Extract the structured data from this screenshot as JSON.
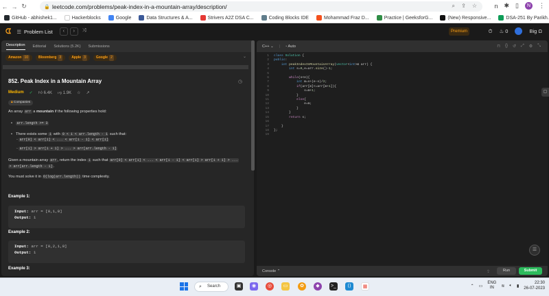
{
  "browser": {
    "url": "leetcode.com/problems/peak-index-in-a-mountain-array/description/",
    "profile_initial": "N",
    "bookmarks": [
      {
        "label": "GitHub - abhishek1...",
        "color": "#24292e"
      },
      {
        "label": "Hackerblocks",
        "color": "#ffffff"
      },
      {
        "label": "Google",
        "color": "#4285f4"
      },
      {
        "label": "Data Structures & A...",
        "color": "#3b5998"
      },
      {
        "label": "Strivers A2Z DSA C...",
        "color": "#e53935"
      },
      {
        "label": "Coding Blocks IDE",
        "color": "#607d8b"
      },
      {
        "label": "Mohammad Fraz D...",
        "color": "#f4511e"
      },
      {
        "label": "Practice | GeeksforG...",
        "color": "#2f8d46"
      },
      {
        "label": "(New) Responsive...",
        "color": "#111111"
      },
      {
        "label": "DSA-251 By Parikh...",
        "color": "#0f9d58"
      }
    ]
  },
  "nav": {
    "problem_list": "Problem List",
    "premium": "Premium",
    "fire_count": "0",
    "username": "Big Ω"
  },
  "tabs": [
    "Description",
    "Editorial",
    "Solutions (5.2K)",
    "Submissions"
  ],
  "company_tags": [
    {
      "name": "Amazon",
      "count": "10"
    },
    {
      "name": "Bloomberg",
      "count": "3"
    },
    {
      "name": "Apple",
      "count": "3"
    },
    {
      "name": "Google",
      "count": "2"
    }
  ],
  "problem": {
    "title": "852. Peak Index in a Mountain Array",
    "difficulty": "Medium",
    "likes": "6.4K",
    "dislikes": "1.9K",
    "companies_label": "Companies"
  },
  "description": {
    "p1_a": "An array ",
    "p1_code": "arr",
    "p1_b": " a ",
    "p1_bold": "mountain",
    "p1_c": " if the following properties hold:",
    "b1": "arr.length >= 3",
    "b2_a": "There exists some ",
    "b2_code1": "i",
    "b2_b": " with ",
    "b2_code2": "0 < i < arr.length - 1",
    "b2_c": " such that:",
    "s1": "arr[0] < arr[1] < ... < arr[i - 1] < arr[i]",
    "s2": "arr[i] > arr[i + 1] > ... > arr[arr.length - 1]",
    "p2_a": "Given a mountain array ",
    "p2_code1": "arr",
    "p2_b": ", return the index ",
    "p2_code2": "i",
    "p2_c": " such that ",
    "p2_code3": "arr[0] < arr[1] < ... < arr[i - 1] < arr[i] > arr[i + 1] > ...",
    "p2_d": "> arr[arr.length - 1]",
    "p2_e": ".",
    "p3_a": "You must solve it in ",
    "p3_code": "O(log(arr.length))",
    "p3_b": " time complexity."
  },
  "examples": [
    {
      "heading": "Example 1:",
      "input_label": "Input:",
      "input": "arr = [0,1,0]",
      "output_label": "Output:",
      "output": "1"
    },
    {
      "heading": "Example 2:",
      "input_label": "Input:",
      "input": "arr = [0,2,1,0]",
      "output_label": "Output:",
      "output": "1"
    },
    {
      "heading": "Example 3:"
    }
  ],
  "editor": {
    "language": "C++",
    "mode": "Auto",
    "console": "Console",
    "run": "Run",
    "submit": "Submit",
    "lines": [
      "1",
      "2",
      "3",
      "4",
      "5",
      "6",
      "7",
      "8",
      "9",
      "10",
      "11",
      "12",
      "13",
      "14",
      "15",
      "16",
      "17",
      "18",
      "19"
    ]
  },
  "taskbar": {
    "search": "Search",
    "lang1": "ENG",
    "lang2": "IN",
    "time": "22:30",
    "date": "26-07-2023"
  }
}
